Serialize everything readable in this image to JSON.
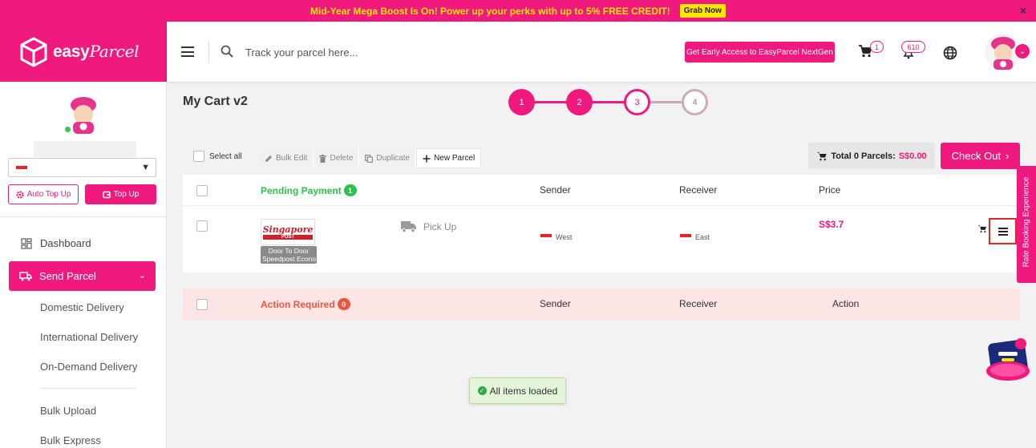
{
  "promo": {
    "text": "Mid-Year Mega Boost Is On! Power up your perks with up to 5% FREE CREDIT!",
    "button": "Grab Now",
    "close": "×"
  },
  "logo": {
    "word1": "easy",
    "word2": "Parcel"
  },
  "topbar": {
    "search_placeholder": "Track your parcel here...",
    "early_access": "Get Early Access to EasyParcel NextGen",
    "cart_count": "1",
    "notif_count": "610"
  },
  "sidebar": {
    "auto_topup": "Auto Top Up",
    "topup": "Top Up",
    "dashboard": "Dashboard",
    "send_parcel": "Send Parcel",
    "sub_items": [
      "Domestic Delivery",
      "International Delivery",
      "On-Demand Delivery",
      "Bulk Upload",
      "Bulk Express"
    ]
  },
  "page": {
    "title": "My Cart v2",
    "steps": [
      "1",
      "2",
      "3",
      "4"
    ]
  },
  "toolbar": {
    "select_all": "Select all",
    "bulk_edit": "Bulk Edit",
    "delete": "Delete",
    "duplicate": "Duplicate",
    "new_parcel": "New Parcel",
    "total_label": "Total 0 Parcels:",
    "total_amount": "S$0.00",
    "checkout": "Check Out"
  },
  "pending": {
    "label": "Pending Payment",
    "count": "1",
    "col_sender": "Sender",
    "col_receiver": "Receiver",
    "col_price": "Price"
  },
  "parcel": {
    "courier_logo_top": "Singapore",
    "courier_logo_bottom": "POST",
    "service_line1": "Door To Door",
    "service_line2": "Speedpost Econo",
    "pickup": "Pick Up",
    "sender_area": "West",
    "receiver_area": "East",
    "price": "S$3.7"
  },
  "action": {
    "label": "Action Required",
    "count": "0",
    "col_sender": "Sender",
    "col_receiver": "Receiver",
    "col_action": "Action"
  },
  "toast": "All items loaded",
  "side_tab": "Rate Booking Experience",
  "colors": {
    "brand": "#f0197d",
    "promo_text": "#ffe600",
    "success": "#2fbf4f",
    "danger": "#e8573f"
  }
}
